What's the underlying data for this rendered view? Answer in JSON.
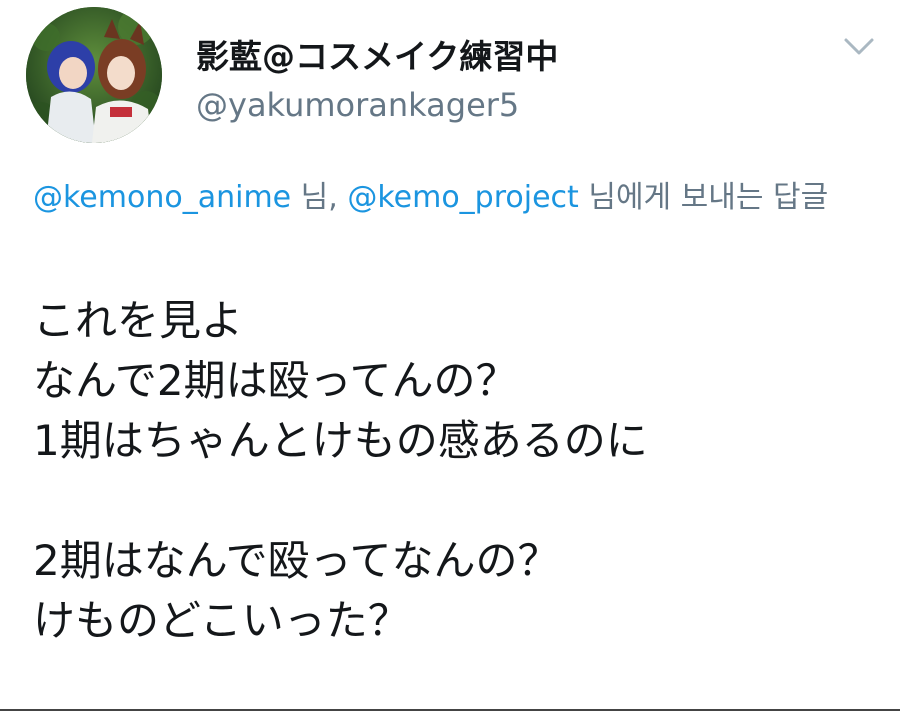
{
  "author": {
    "display_name": "影藍@コスメイク練習中",
    "handle": "@yakumorankager5",
    "avatar_icon": "user-avatar-image"
  },
  "menu": {
    "icon": "chevron-down-icon"
  },
  "reply_context": {
    "mention_1": "@kemono_anime",
    "separator_1": " 님, ",
    "mention_2": "@kemo_project",
    "suffix": " 님에게 보내는 답글"
  },
  "tweet": {
    "lines": [
      "これを見よ",
      "なんで2期は殴ってんの？",
      "1期はちゃんとけもの感あるのに",
      "",
      "2期はなんで殴ってなんの？",
      "けものどこいった？"
    ]
  },
  "colors": {
    "text": "#14171a",
    "secondary": "#657786",
    "link": "#1b95e0"
  }
}
